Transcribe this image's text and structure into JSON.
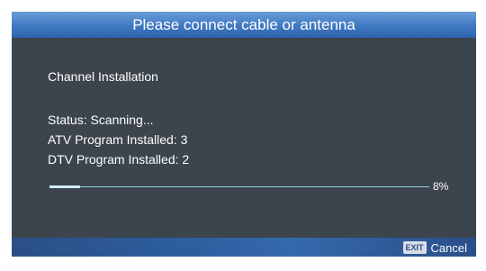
{
  "dialog": {
    "header_title": "Please connect cable or antenna",
    "section_title": "Channel Installation",
    "status_text": "Status: Scanning...",
    "atv_text": "ATV Program Installed: 3",
    "dtv_text": "DTV Program Installed: 2",
    "progress": {
      "value": 8,
      "label": "8%"
    },
    "footer": {
      "exit_key_label": "EXIT",
      "cancel_label": "Cancel"
    }
  },
  "colors": {
    "panel_bg": "#3c444c",
    "header_blue": "#3f78c2",
    "footer_blue": "#2d5fa0",
    "progress_line": "#9ad0ea",
    "text": "#ffffff"
  }
}
